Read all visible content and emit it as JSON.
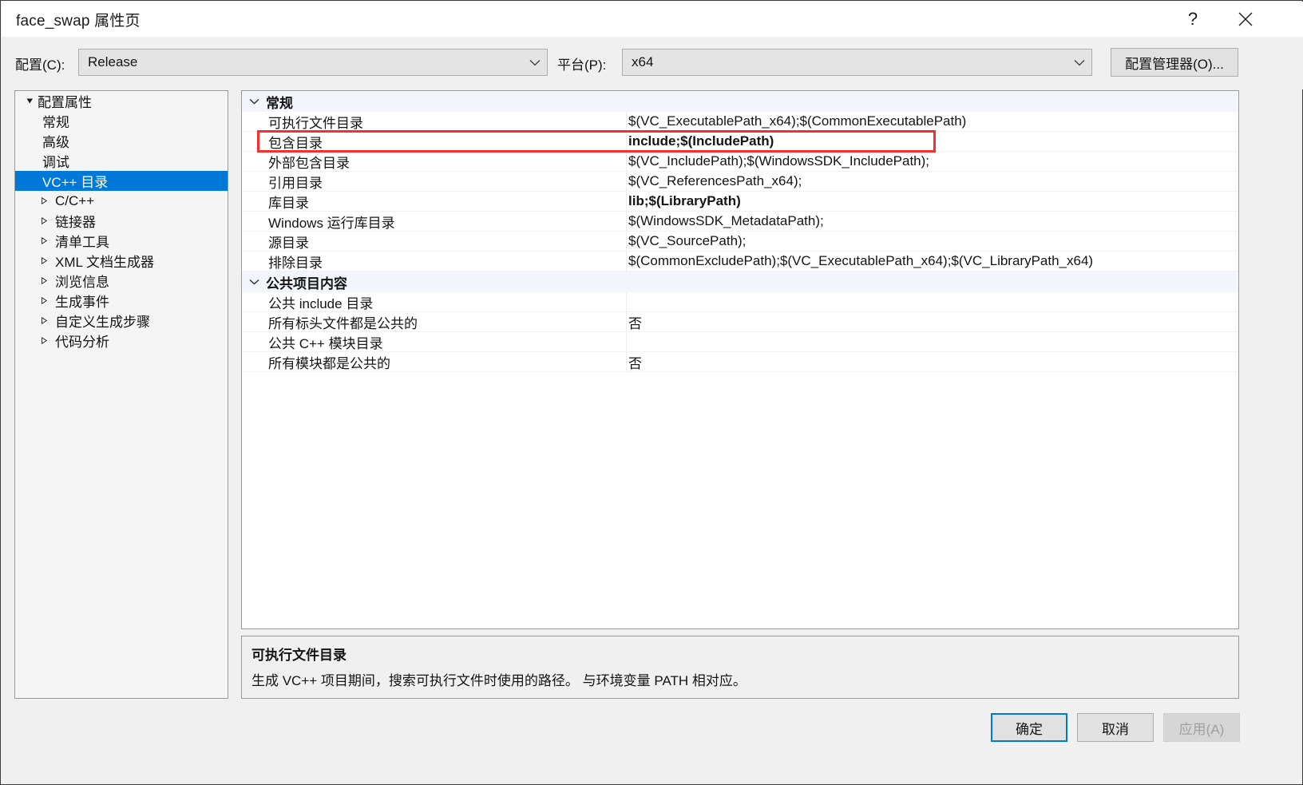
{
  "window": {
    "title": "face_swap 属性页",
    "help_icon": "question-mark-icon",
    "close_icon": "close-icon"
  },
  "toolbar": {
    "config_label": "配置(C):",
    "config_value": "Release",
    "platform_label": "平台(P):",
    "platform_value": "x64",
    "config_manager_label": "配置管理器(O)..."
  },
  "tree": {
    "items": [
      {
        "label": "配置属性",
        "level": 0,
        "arrow": "expanded",
        "selected": false
      },
      {
        "label": "常规",
        "level": 1,
        "arrow": "none",
        "selected": false
      },
      {
        "label": "高级",
        "level": 1,
        "arrow": "none",
        "selected": false
      },
      {
        "label": "调试",
        "level": 1,
        "arrow": "none",
        "selected": false
      },
      {
        "label": "VC++ 目录",
        "level": 1,
        "arrow": "none",
        "selected": true
      },
      {
        "label": "C/C++",
        "level": 1,
        "arrow": "collapsed",
        "selected": false
      },
      {
        "label": "链接器",
        "level": 1,
        "arrow": "collapsed",
        "selected": false
      },
      {
        "label": "清单工具",
        "level": 1,
        "arrow": "collapsed",
        "selected": false
      },
      {
        "label": "XML 文档生成器",
        "level": 1,
        "arrow": "collapsed",
        "selected": false
      },
      {
        "label": "浏览信息",
        "level": 1,
        "arrow": "collapsed",
        "selected": false
      },
      {
        "label": "生成事件",
        "level": 1,
        "arrow": "collapsed",
        "selected": false
      },
      {
        "label": "自定义生成步骤",
        "level": 1,
        "arrow": "collapsed",
        "selected": false
      },
      {
        "label": "代码分析",
        "level": 1,
        "arrow": "collapsed",
        "selected": false
      }
    ]
  },
  "grid": {
    "sections": [
      {
        "title": "常规",
        "expanded": true,
        "rows": [
          {
            "name": "可执行文件目录",
            "value": "$(VC_ExecutablePath_x64);$(CommonExecutablePath)",
            "bold": false
          },
          {
            "name": "包含目录",
            "value": "include;$(IncludePath)",
            "bold": true,
            "highlighted": true
          },
          {
            "name": "外部包含目录",
            "value": "$(VC_IncludePath);$(WindowsSDK_IncludePath);",
            "bold": false
          },
          {
            "name": "引用目录",
            "value": "$(VC_ReferencesPath_x64);",
            "bold": false
          },
          {
            "name": "库目录",
            "value": "lib;$(LibraryPath)",
            "bold": true
          },
          {
            "name": "Windows 运行库目录",
            "value": "$(WindowsSDK_MetadataPath);",
            "bold": false
          },
          {
            "name": "源目录",
            "value": "$(VC_SourcePath);",
            "bold": false
          },
          {
            "name": "排除目录",
            "value": "$(CommonExcludePath);$(VC_ExecutablePath_x64);$(VC_LibraryPath_x64)",
            "bold": false
          }
        ]
      },
      {
        "title": "公共项目内容",
        "expanded": true,
        "rows": [
          {
            "name": "公共 include 目录",
            "value": "",
            "bold": false
          },
          {
            "name": "所有标头文件都是公共的",
            "value": "否",
            "bold": false
          },
          {
            "name": "公共 C++ 模块目录",
            "value": "",
            "bold": false
          },
          {
            "name": "所有模块都是公共的",
            "value": "否",
            "bold": false
          }
        ]
      }
    ]
  },
  "description": {
    "title": "可执行文件目录",
    "body": "生成 VC++ 项目期间，搜索可执行文件时使用的路径。 与环境变量 PATH 相对应。"
  },
  "footer": {
    "ok_label": "确定",
    "cancel_label": "取消",
    "apply_label": "应用(A)"
  },
  "colors": {
    "accent": "#0078d7",
    "highlight_box": "#f23030",
    "section_header_bg": "#f2f5fa",
    "dialog_bg": "#f0f0f0"
  }
}
